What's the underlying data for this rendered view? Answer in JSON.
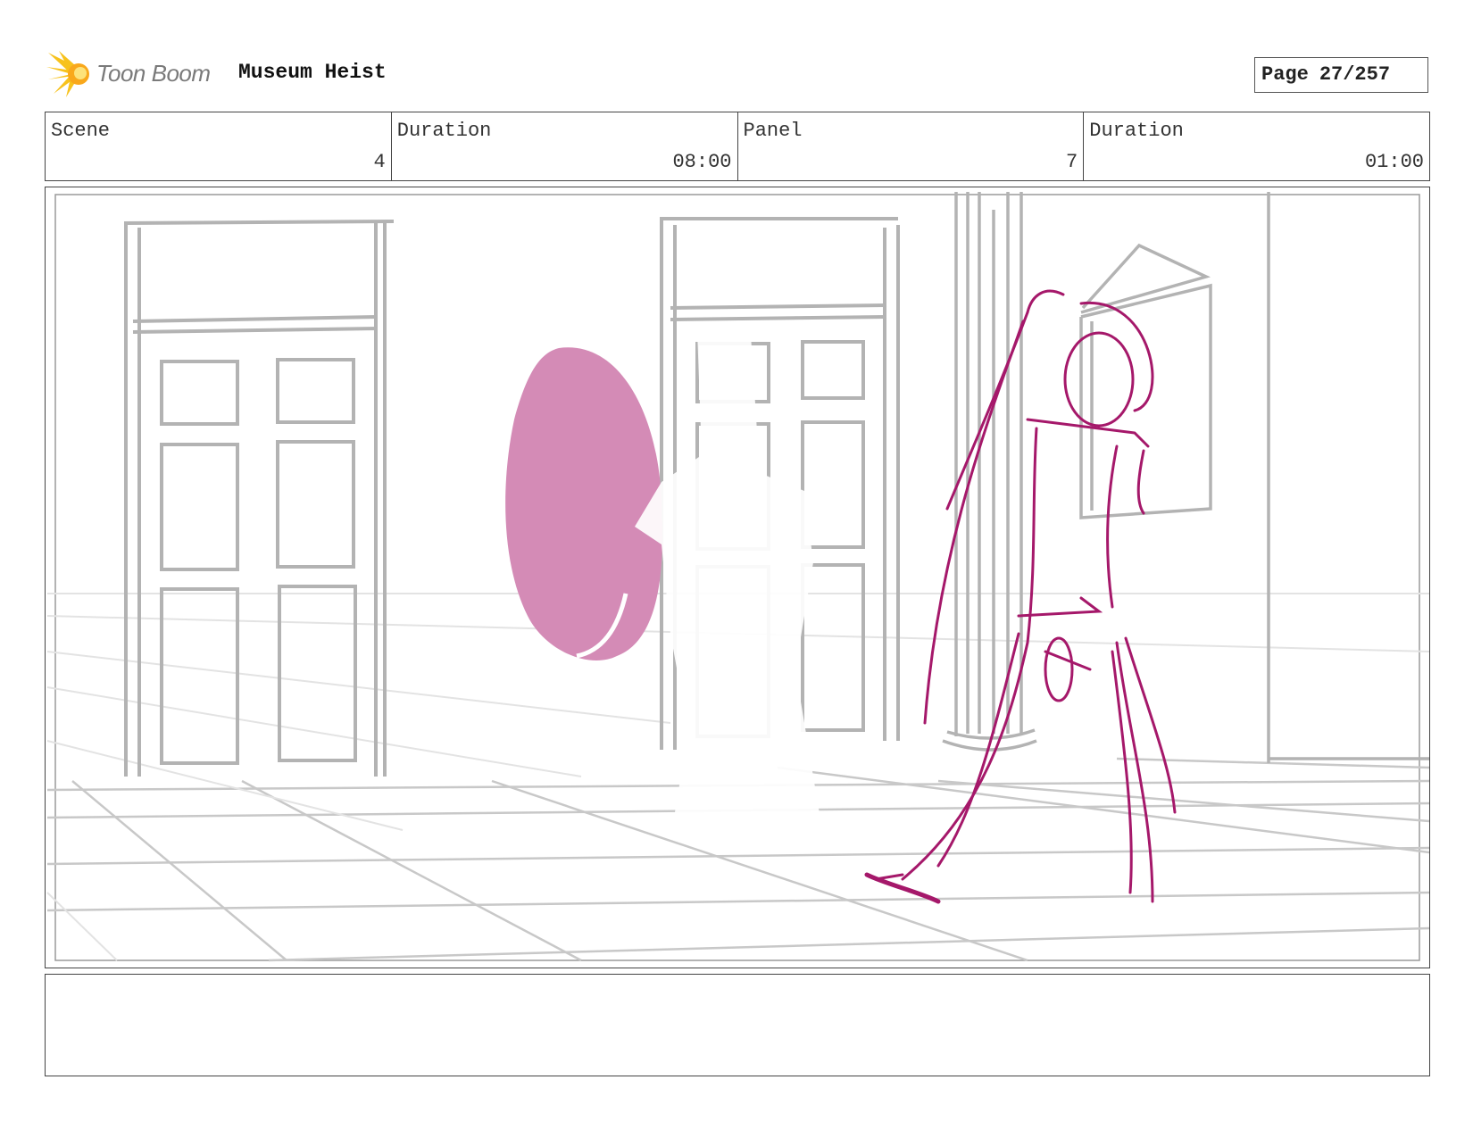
{
  "header": {
    "logo_text": "Toon Boom",
    "project_title": "Museum Heist",
    "page_label": "Page",
    "page_number": "27/257"
  },
  "info": {
    "scene_label": "Scene",
    "scene_value": "4",
    "scene_duration_label": "Duration",
    "scene_duration_value": "08:00",
    "panel_label": "Panel",
    "panel_value": "7",
    "panel_duration_label": "Duration",
    "panel_duration_value": "01:00"
  },
  "colors": {
    "sketch_gray": "#b3b3b3",
    "character_magenta": "#a5186a",
    "blob_pink": "#d48bb6",
    "logo_yellow": "#f7c21c"
  },
  "notes": {
    "text": ""
  }
}
